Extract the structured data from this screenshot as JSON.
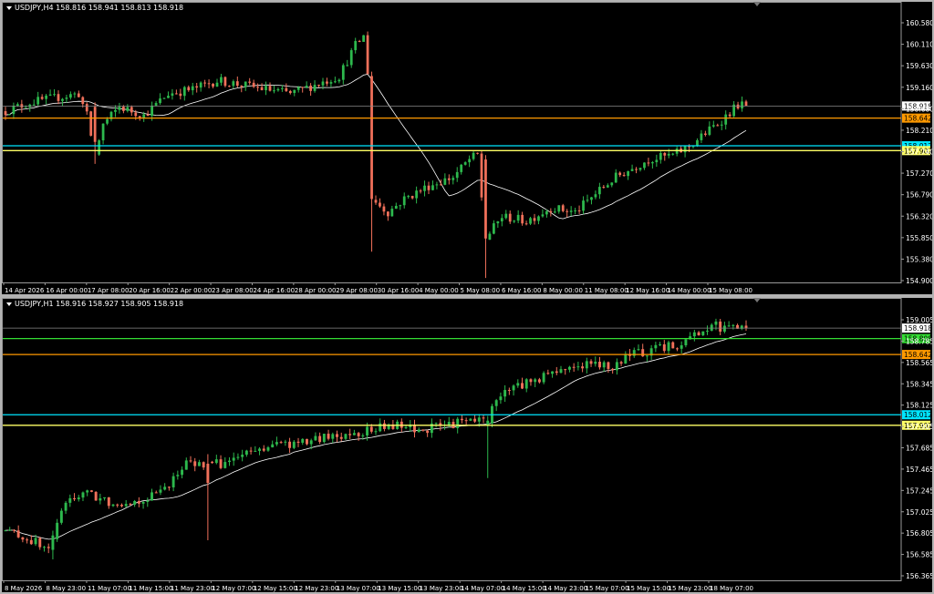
{
  "panes": [
    {
      "id": "h4",
      "title": "USDJPY,H4  158.816 158.941 158.813 158.918",
      "chart_data": {
        "type": "candlestick",
        "title": "USDJPY,H4  158.816 158.941 158.813 158.918",
        "xlabel": "",
        "ylabel": "",
        "ylim": [
          154.9,
          161.0
        ],
        "y_ticks": [
          "160.580",
          "160.110",
          "159.630",
          "159.160",
          "158.680",
          "158.210",
          "157.740",
          "157.270",
          "156.790",
          "156.320",
          "155.850",
          "155.380",
          "154.900"
        ],
        "x_ticks": [
          "14 Apr 2026",
          "16 Apr 00:00",
          "17 Apr 08:00",
          "20 Apr 16:00",
          "22 Apr 00:00",
          "23 Apr 08:00",
          "24 Apr 16:00",
          "28 Apr 00:00",
          "29 Apr 08:00",
          "30 Apr 16:00",
          "4 May 00:00",
          "5 May 08:00",
          "6 May 16:00",
          "8 May 00:00",
          "11 May 08:00",
          "12 May 16:00",
          "14 May 00:00",
          "15 May 08:00"
        ],
        "levels": [
          {
            "label": "158.642",
            "value": 158.642,
            "color": "#ff9900"
          },
          {
            "label": "158.012",
            "value": 158.012,
            "color": "#00e5ff"
          },
          {
            "label": "157.902",
            "value": 157.902,
            "color": "#ffff66"
          }
        ],
        "current_price": {
          "label": "158.918",
          "value": 158.918
        },
        "bull_color": "#2db84d",
        "bear_color": "#f0705a",
        "ma_color": "#ffffff",
        "grid": false,
        "key_points": [
          [
            0,
            158.8
          ],
          [
            6,
            159.0
          ],
          [
            12,
            159.1
          ],
          [
            18,
            159.2
          ],
          [
            20,
            158.7
          ],
          [
            22,
            157.8
          ],
          [
            24,
            158.5
          ],
          [
            28,
            158.9
          ],
          [
            34,
            158.7
          ],
          [
            40,
            159.2
          ],
          [
            46,
            159.3
          ],
          [
            52,
            159.5
          ],
          [
            58,
            159.4
          ],
          [
            64,
            159.3
          ],
          [
            70,
            159.2
          ],
          [
            76,
            159.4
          ],
          [
            82,
            159.6
          ],
          [
            86,
            160.3
          ],
          [
            88,
            160.5
          ],
          [
            89,
            159.7
          ],
          [
            90,
            156.8
          ],
          [
            94,
            156.5
          ],
          [
            98,
            156.8
          ],
          [
            104,
            157.1
          ],
          [
            110,
            157.3
          ],
          [
            114,
            157.7
          ],
          [
            116,
            157.8
          ],
          [
            118,
            155.9
          ],
          [
            122,
            156.4
          ],
          [
            128,
            156.3
          ],
          [
            134,
            156.6
          ],
          [
            140,
            156.5
          ],
          [
            146,
            157.0
          ],
          [
            150,
            157.3
          ],
          [
            154,
            157.5
          ],
          [
            158,
            157.7
          ],
          [
            164,
            157.8
          ],
          [
            168,
            158.0
          ],
          [
            172,
            158.3
          ],
          [
            176,
            158.6
          ],
          [
            180,
            158.95
          ],
          [
            182,
            158.92
          ]
        ],
        "big_moves": [
          {
            "i": 90,
            "o": 159.6,
            "c": 156.8,
            "h": 159.7,
            "l": 155.6
          },
          {
            "i": 22,
            "o": 158.9,
            "c": 158.1,
            "h": 159.0,
            "l": 157.6
          },
          {
            "i": 118,
            "o": 157.7,
            "c": 155.9,
            "h": 157.8,
            "l": 155.0
          }
        ]
      }
    },
    {
      "id": "h1",
      "title": "USDJPY,H1  158.916 158.927 158.905 158.918",
      "chart_data": {
        "type": "candlestick",
        "title": "USDJPY,H1  158.916 158.927 158.905 158.918",
        "xlabel": "",
        "ylabel": "",
        "ylim": [
          156.3,
          159.1
        ],
        "y_ticks": [
          "159.005",
          "158.785",
          "158.565",
          "158.345",
          "158.125",
          "157.905",
          "157.685",
          "157.465",
          "157.245",
          "157.025",
          "156.805",
          "156.585",
          "156.365"
        ],
        "x_ticks": [
          "8 May 2026",
          "8 May 23:00",
          "11 May 07:00",
          "11 May 15:00",
          "11 May 23:00",
          "12 May 07:00",
          "12 May 15:00",
          "12 May 23:00",
          "13 May 07:00",
          "13 May 15:00",
          "13 May 23:00",
          "14 May 07:00",
          "14 May 15:00",
          "14 May 23:00",
          "15 May 07:00",
          "15 May 15:00",
          "15 May 23:00",
          "18 May 07:00"
        ],
        "levels": [
          {
            "label": "158.808",
            "value": 158.808,
            "color": "#33dd33"
          },
          {
            "label": "158.642",
            "value": 158.642,
            "color": "#ff9900"
          },
          {
            "label": "158.012",
            "value": 158.012,
            "color": "#00e5ff"
          },
          {
            "label": "157.902",
            "value": 157.902,
            "color": "#ffff66"
          }
        ],
        "current_price": {
          "label": "158.918",
          "value": 158.918
        },
        "bull_color": "#2db84d",
        "bear_color": "#f0705a",
        "ma_color": "#ffffff",
        "grid": false,
        "key_points": [
          [
            0,
            156.8
          ],
          [
            6,
            156.7
          ],
          [
            10,
            156.6
          ],
          [
            14,
            157.1
          ],
          [
            18,
            157.2
          ],
          [
            24,
            157.1
          ],
          [
            30,
            157.1
          ],
          [
            36,
            157.2
          ],
          [
            42,
            157.5
          ],
          [
            46,
            157.5
          ],
          [
            50,
            157.5
          ],
          [
            56,
            157.6
          ],
          [
            62,
            157.7
          ],
          [
            68,
            157.7
          ],
          [
            72,
            157.75
          ],
          [
            78,
            157.8
          ],
          [
            84,
            157.85
          ],
          [
            90,
            157.9
          ],
          [
            96,
            157.85
          ],
          [
            102,
            157.9
          ],
          [
            108,
            157.95
          ],
          [
            112,
            157.95
          ],
          [
            114,
            158.2
          ],
          [
            118,
            158.3
          ],
          [
            124,
            158.4
          ],
          [
            130,
            158.5
          ],
          [
            136,
            158.55
          ],
          [
            140,
            158.5
          ],
          [
            146,
            158.65
          ],
          [
            152,
            158.7
          ],
          [
            156,
            158.75
          ],
          [
            160,
            158.85
          ],
          [
            164,
            158.95
          ],
          [
            168,
            158.9
          ],
          [
            172,
            158.92
          ]
        ],
        "big_moves": [
          {
            "i": 47,
            "o": 157.5,
            "c": 157.3,
            "h": 157.6,
            "l": 156.7
          },
          {
            "i": 112,
            "o": 157.9,
            "c": 157.95,
            "h": 158.0,
            "l": 157.35
          },
          {
            "i": 11,
            "o": 156.6,
            "c": 156.75,
            "h": 156.8,
            "l": 156.5
          }
        ]
      }
    }
  ]
}
